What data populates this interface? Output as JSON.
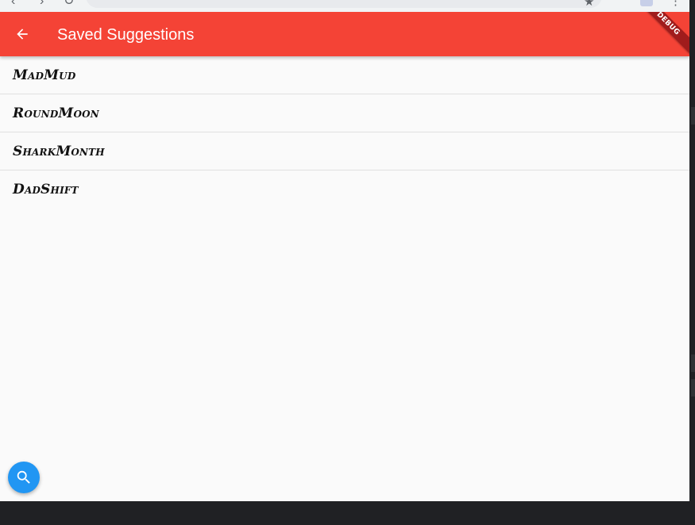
{
  "appbar": {
    "title": "Saved Suggestions",
    "back_icon": "arrow-back-icon",
    "color": "#f44336"
  },
  "debug_banner": {
    "label": "DEBUG"
  },
  "saved_list": {
    "items": [
      {
        "label": "MadMud"
      },
      {
        "label": "RoundMoon"
      },
      {
        "label": "SharkMonth"
      },
      {
        "label": "DadShift"
      }
    ]
  },
  "fab": {
    "icon": "search-icon",
    "color": "#2196f3"
  }
}
